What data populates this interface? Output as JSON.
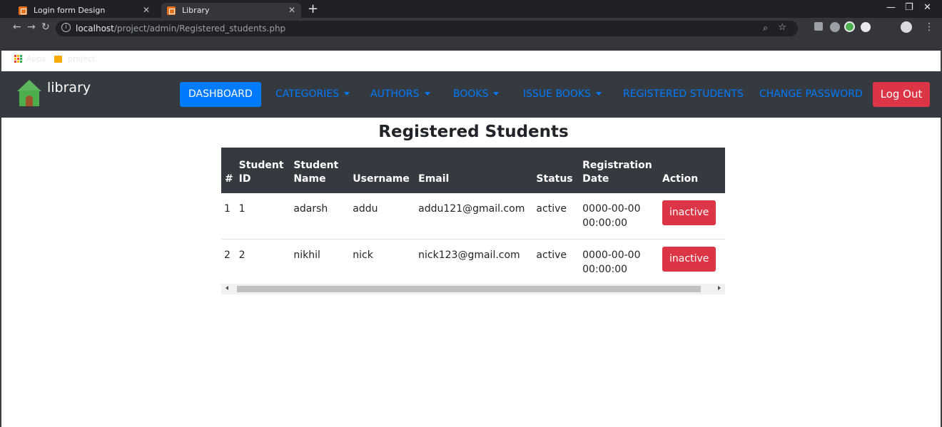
{
  "browser": {
    "tabs": [
      {
        "title": "Login form Design",
        "active": false
      },
      {
        "title": "Library",
        "active": true
      }
    ],
    "new_tab": "+",
    "url_host": "localhost",
    "url_path": "/project/admin/Registered_students.php",
    "bookmarks": [
      {
        "label": "Apps",
        "icon": "apps-grid-icon"
      },
      {
        "label": "project",
        "icon": "folder-icon"
      }
    ]
  },
  "navbar": {
    "brand": "library",
    "items": [
      {
        "label": "DASHBOARD",
        "active": true,
        "dropdown": false
      },
      {
        "label": "CATEGORIES",
        "active": false,
        "dropdown": true
      },
      {
        "label": "AUTHORS",
        "active": false,
        "dropdown": true
      },
      {
        "label": "BOOKS",
        "active": false,
        "dropdown": true
      },
      {
        "label": "ISSUE BOOKS",
        "active": false,
        "dropdown": true
      },
      {
        "label": "REGISTERED STUDENTS",
        "active": false,
        "dropdown": false
      },
      {
        "label": "CHANGE PASSWORD",
        "active": false,
        "dropdown": false
      }
    ],
    "logout": "Log Out"
  },
  "page": {
    "title": "Registered Students"
  },
  "table": {
    "headers": [
      "#",
      "Student ID",
      "Student Name",
      "Username",
      "Email",
      "Status",
      "Registration Date",
      "Action"
    ],
    "rows": [
      {
        "num": "1",
        "student_id": "1",
        "name": "adarsh",
        "username": "addu",
        "email": "addu121@gmail.com",
        "status": "active",
        "reg_date_1": "0000-00-00",
        "reg_date_2": "00:00:00",
        "action": "inactive"
      },
      {
        "num": "2",
        "student_id": "2",
        "name": "nikhil",
        "username": "nick",
        "email": "nick123@gmail.com",
        "status": "active",
        "reg_date_1": "0000-00-00",
        "reg_date_2": "00:00:00",
        "action": "inactive"
      }
    ]
  },
  "colors": {
    "navbar_bg": "#343a40",
    "primary": "#007bff",
    "danger": "#dc3545"
  }
}
